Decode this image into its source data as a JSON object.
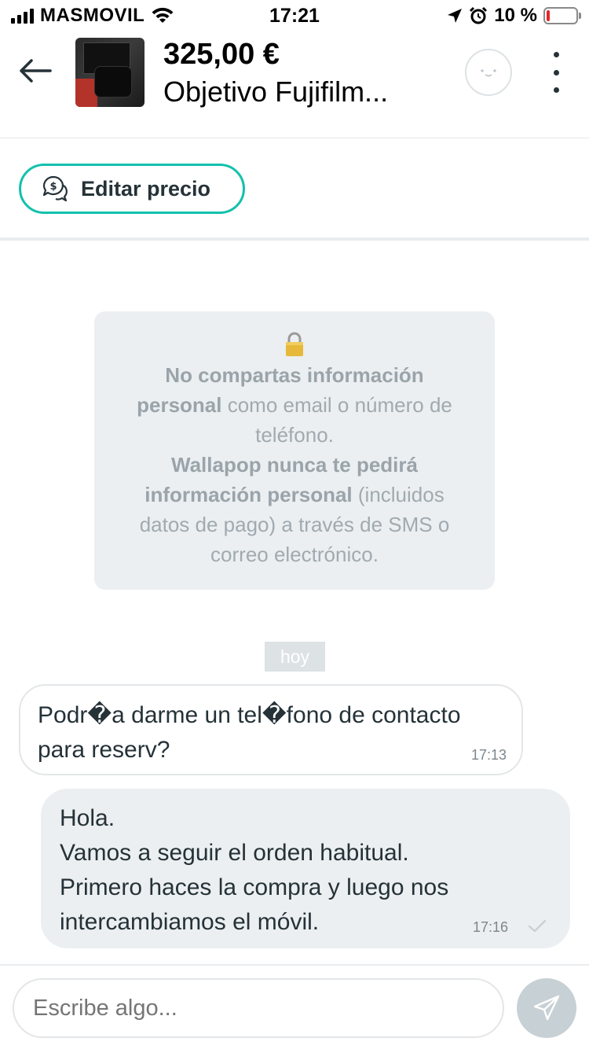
{
  "status_bar": {
    "carrier": "MASMOVIL",
    "time": "17:21",
    "battery": "10 %",
    "battery_level": 0.1,
    "icons": [
      "signal-icon",
      "wifi-icon",
      "location-icon",
      "alarm-icon",
      "battery-icon"
    ]
  },
  "header": {
    "price": "325,00 €",
    "title": "Objetivo Fujifilm..."
  },
  "edit_price": {
    "label": "Editar precio"
  },
  "info_card": {
    "line1_bold": "No compartas información personal",
    "line1_rest": " como email o número de teléfono.",
    "line2_bold": "Wallapop nunca te pedirá información personal",
    "line2_rest": " (incluidos datos de pago) a través de SMS o correo electrónico."
  },
  "day_label": "hoy",
  "messages": [
    {
      "direction": "incoming",
      "text": "Podr�a darme un tel�fono de contacto para reserv?",
      "time": "17:13"
    },
    {
      "direction": "outgoing",
      "text": "Hola.\nVamos a seguir el orden habitual.\nPrimero haces la compra y luego nos intercambiamos el móvil.",
      "time": "17:16"
    }
  ],
  "input": {
    "placeholder": "Escribe algo..."
  },
  "colors": {
    "accent": "#13c1ac",
    "bubble_out": "#eceff1",
    "send_button": "#c7d0d5",
    "battery_low": "#e4252b"
  }
}
